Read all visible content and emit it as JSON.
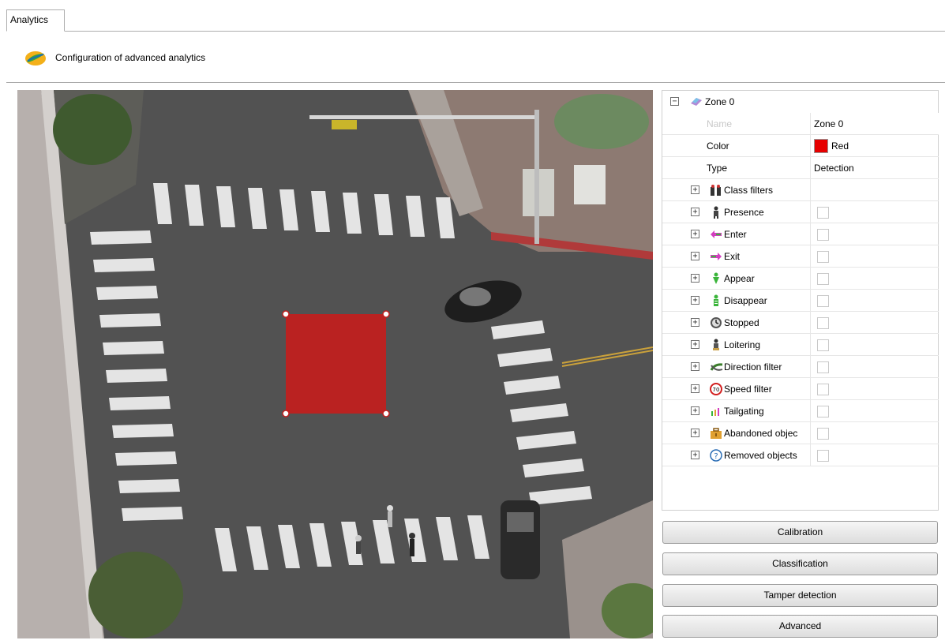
{
  "tab": {
    "label": "Analytics"
  },
  "header": {
    "title": "Configuration of advanced analytics"
  },
  "zone": {
    "title": "Zone 0",
    "properties": [
      {
        "label": "Name",
        "value": "Zone 0"
      },
      {
        "label": "Color",
        "value": "Red",
        "color": "#e60000"
      },
      {
        "label": "Type",
        "value": "Detection"
      }
    ],
    "filters": [
      {
        "label": "Class filters",
        "icon": "class-filters-icon",
        "has_checkbox": false
      },
      {
        "label": "Presence",
        "icon": "presence-icon",
        "has_checkbox": true
      },
      {
        "label": "Enter",
        "icon": "enter-icon",
        "has_checkbox": true
      },
      {
        "label": "Exit",
        "icon": "exit-icon",
        "has_checkbox": true
      },
      {
        "label": "Appear",
        "icon": "appear-icon",
        "has_checkbox": true
      },
      {
        "label": "Disappear",
        "icon": "disappear-icon",
        "has_checkbox": true
      },
      {
        "label": "Stopped",
        "icon": "stopped-icon",
        "has_checkbox": true
      },
      {
        "label": "Loitering",
        "icon": "loitering-icon",
        "has_checkbox": true
      },
      {
        "label": "Direction filter",
        "icon": "direction-filter-icon",
        "has_checkbox": true
      },
      {
        "label": "Speed filter",
        "icon": "speed-filter-icon",
        "has_checkbox": true
      },
      {
        "label": "Tailgating",
        "icon": "tailgating-icon",
        "has_checkbox": true
      },
      {
        "label": "Abandoned objec",
        "icon": "abandoned-object-icon",
        "has_checkbox": true
      },
      {
        "label": "Removed objects",
        "icon": "removed-objects-icon",
        "has_checkbox": true
      }
    ],
    "speed_sign": "70"
  },
  "buttons": {
    "calibration": "Calibration",
    "classification": "Classification",
    "tamper": "Tamper detection",
    "advanced": "Advanced"
  },
  "colors": {
    "zone_fill": "#c0201f",
    "accent": "#e60000"
  }
}
